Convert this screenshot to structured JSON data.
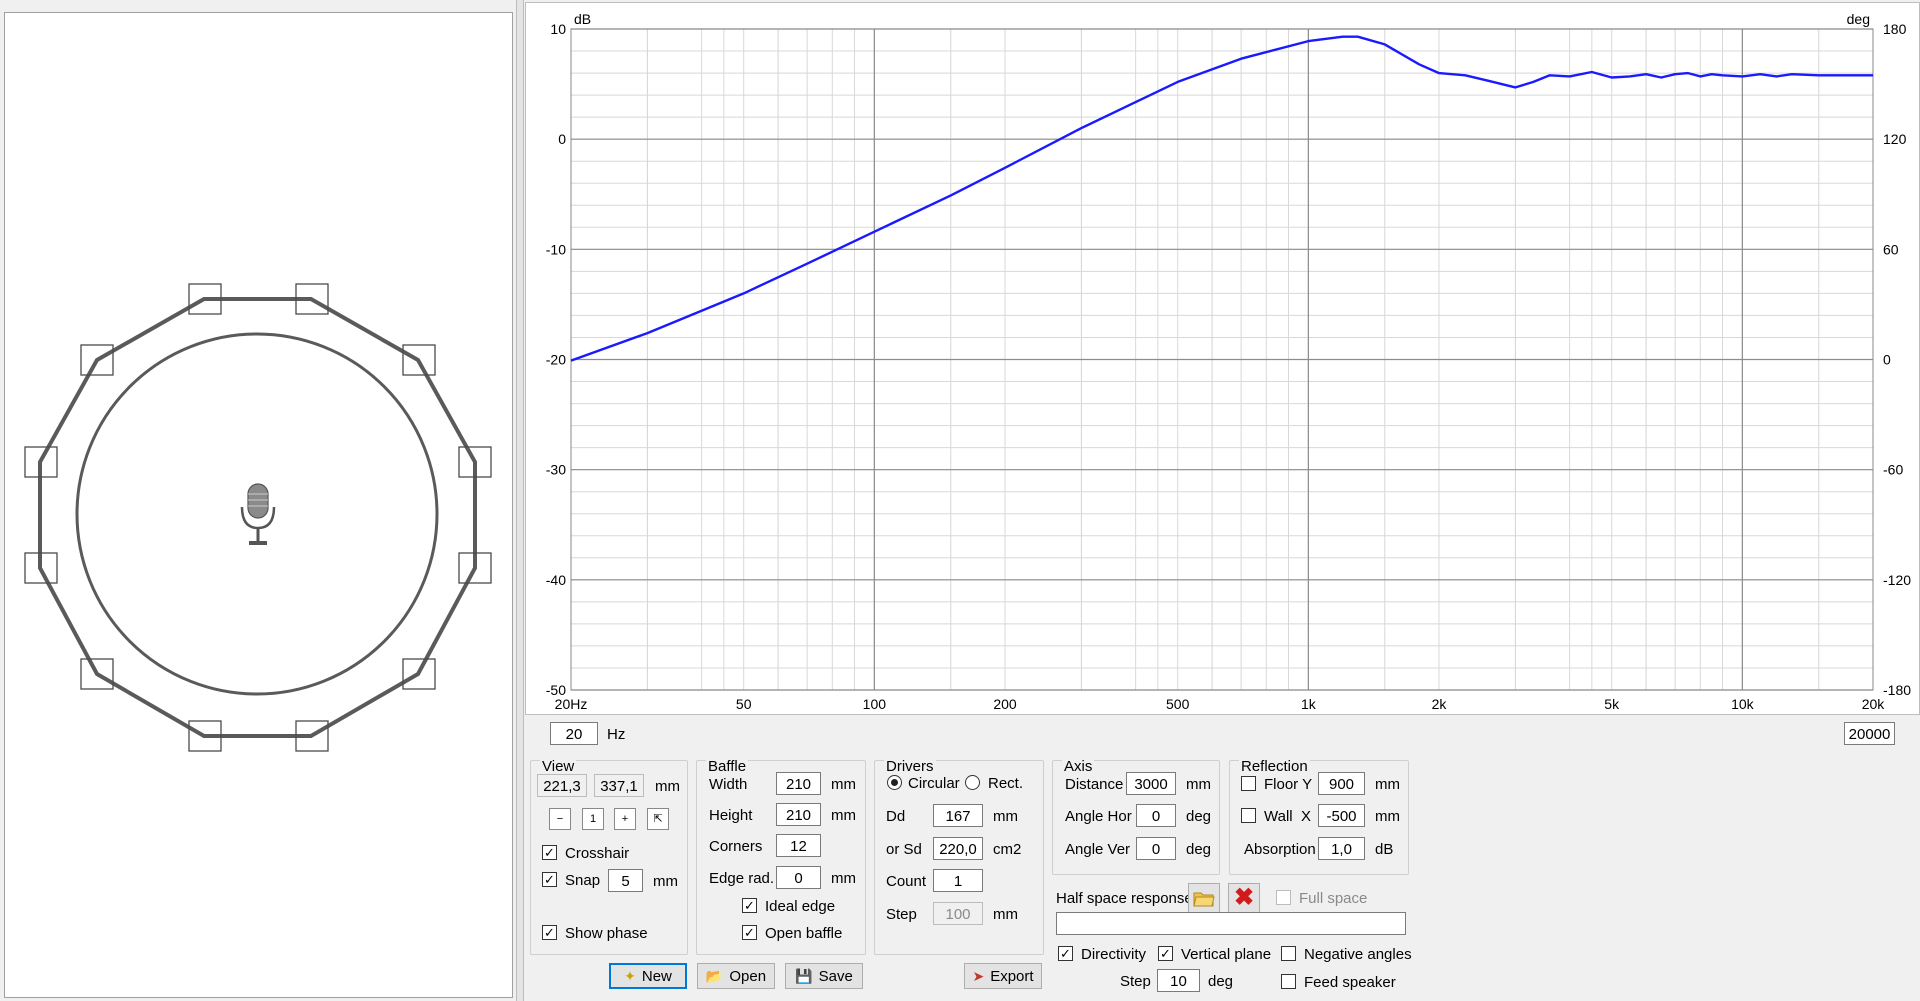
{
  "chart_data": {
    "type": "line",
    "xscale": "log",
    "xlim": [
      20,
      20000
    ],
    "ylim": [
      -50,
      10
    ],
    "ylim_right": [
      -180,
      180
    ],
    "xlabel": "Hz",
    "ylabel": "dB",
    "ylabel_right": "deg",
    "x_ticks": [
      "20Hz",
      "50",
      "100",
      "200",
      "500",
      "1k",
      "2k",
      "5k",
      "10k",
      "20k"
    ],
    "y_ticks": [
      "10",
      "0",
      "-10",
      "-20",
      "-30",
      "-40",
      "-50"
    ],
    "y_right_ticks": [
      "180",
      "120",
      "60",
      "0",
      "-60",
      "-120",
      "-180"
    ],
    "grid": true,
    "series": [
      {
        "color": "#1a1aff",
        "x": [
          20,
          30,
          50,
          70,
          100,
          150,
          200,
          300,
          500,
          700,
          1000,
          1200,
          1300,
          1500,
          1800,
          2000,
          2300,
          2600,
          3000,
          3300,
          3600,
          4000,
          4500,
          5000,
          5500,
          6000,
          6500,
          7000,
          7500,
          8000,
          8500,
          9000,
          10000,
          11000,
          12000,
          13000,
          15000,
          17000,
          20000
        ],
        "y": [
          -20.1,
          -17.6,
          -14.0,
          -11.3,
          -8.4,
          -5.1,
          -2.6,
          1.0,
          5.2,
          7.3,
          8.9,
          9.3,
          9.3,
          8.6,
          6.8,
          6.0,
          5.8,
          5.3,
          4.7,
          5.2,
          5.8,
          5.7,
          6.1,
          5.6,
          5.7,
          5.9,
          5.6,
          5.9,
          6.0,
          5.7,
          5.9,
          5.8,
          5.7,
          5.9,
          5.7,
          5.9,
          5.8,
          5.8,
          5.8
        ]
      }
    ]
  },
  "range": {
    "min": "20",
    "unit": "Hz",
    "max": "20000"
  },
  "view": {
    "title": "View",
    "x": "221,3",
    "y": "337,1",
    "unit": "mm",
    "crosshair": "Crosshair",
    "snap": "Snap",
    "snap_value": "5",
    "snap_unit": "mm",
    "show_phase": "Show phase"
  },
  "baffle": {
    "title": "Baffle",
    "width_label": "Width",
    "width": "210",
    "height_label": "Height",
    "height": "210",
    "corners_label": "Corners",
    "corners": "12",
    "edge_label": "Edge rad.",
    "edge": "0",
    "unit": "mm",
    "ideal_edge": "Ideal edge",
    "open_baffle": "Open baffle"
  },
  "drivers": {
    "title": "Drivers",
    "circular": "Circular",
    "rect": "Rect.",
    "dd_label": "Dd",
    "dd": "167",
    "dd_unit": "mm",
    "sd_label": "or Sd",
    "sd": "220,0",
    "sd_unit": "cm2",
    "count_label": "Count",
    "count": "1",
    "step_label": "Step",
    "step": "100",
    "step_unit": "mm"
  },
  "axis": {
    "title": "Axis",
    "distance_label": "Distance",
    "distance": "3000",
    "distance_unit": "mm",
    "hor_label": "Angle Hor",
    "hor": "0",
    "ver_label": "Angle Ver",
    "ver": "0",
    "deg": "deg"
  },
  "reflection": {
    "title": "Reflection",
    "floor_label": "Floor Y",
    "floor": "900",
    "wall_label": "Wall  X",
    "wall": "-500",
    "mm": "mm",
    "absorption_label": "Absorption",
    "absorption": "1,0",
    "db": "dB"
  },
  "half_space": {
    "label": "Half space response",
    "full_space": "Full space",
    "path": ""
  },
  "options": {
    "directivity": "Directivity",
    "vertical_plane": "Vertical plane",
    "negative_angles": "Negative angles",
    "feed_speaker": "Feed speaker",
    "step_label": "Step",
    "step": "10",
    "step_unit": "deg"
  },
  "buttons": {
    "new": "New",
    "open": "Open",
    "save": "Save",
    "export": "Export"
  },
  "colors": {
    "curve": "#1a1aff",
    "baffle": "#5a5a5a",
    "grid_major": "#8c8c8c",
    "grid_minor": "#d8d8d8"
  }
}
